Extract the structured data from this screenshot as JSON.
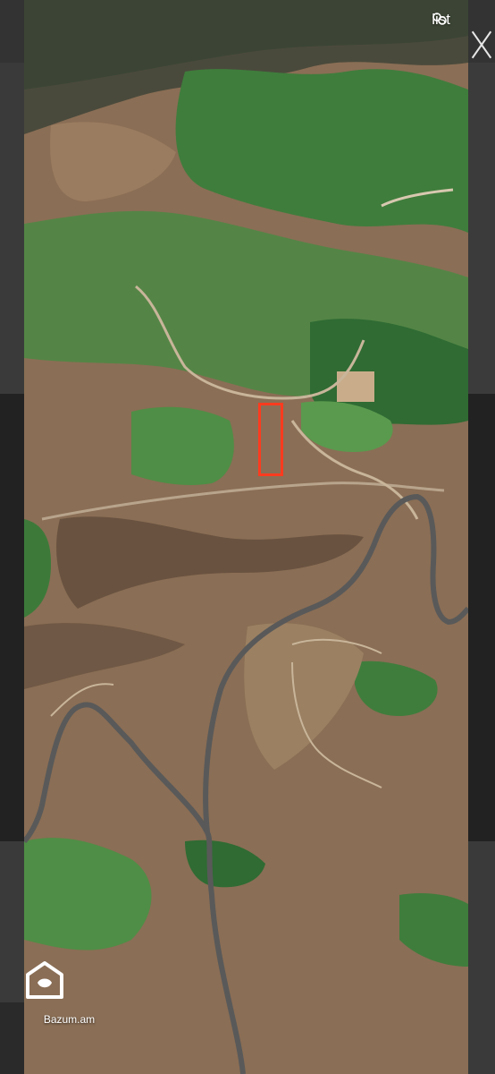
{
  "viewer": {
    "list_label": "list",
    "list_icon": "list-icon",
    "close_icon": "close-icon",
    "watermark_text": "Bazum.am",
    "watermark_icon": "bazum-logo-icon"
  },
  "colors": {
    "marker": "#ff3b1f",
    "terrain": "#8a6e55",
    "vegetation": "#3f7d3c",
    "road": "#5a5a5a"
  }
}
